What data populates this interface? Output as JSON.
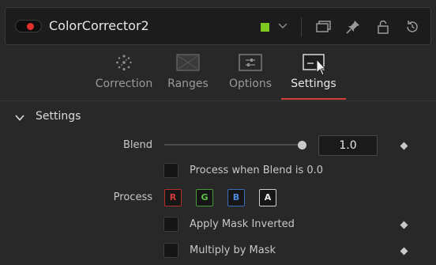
{
  "node": {
    "name": "ColorCorrector2",
    "toggle_color": "#e0322b",
    "swatch_color": "#7fc81d"
  },
  "titlebar_icons": [
    "color-swatch-dropdown-icon",
    "window-icon",
    "pin-icon",
    "lock-icon",
    "reset-icon"
  ],
  "tabs": [
    {
      "label": "Correction",
      "icon": "color-wheel-icon"
    },
    {
      "label": "Ranges",
      "icon": "image-icon"
    },
    {
      "label": "Options",
      "icon": "options-icon"
    },
    {
      "label": "Settings",
      "icon": "settings-icon",
      "active": true
    }
  ],
  "accent_color": "#d2413a",
  "section": {
    "title": "Settings",
    "blend": {
      "label": "Blend",
      "value": "1.0",
      "slider_fraction": 1.0
    },
    "process_when_blend_zero": {
      "label": "Process when Blend is 0.0",
      "checked": false
    },
    "process": {
      "label": "Process",
      "channels": [
        {
          "letter": "R",
          "color": "#d83a3a"
        },
        {
          "letter": "G",
          "color": "#5ec24a"
        },
        {
          "letter": "B",
          "color": "#3f7fd6"
        },
        {
          "letter": "A",
          "color": "#e8e8e8"
        }
      ]
    },
    "apply_mask_inverted": {
      "label": "Apply Mask Inverted",
      "checked": false
    },
    "multiply_by_mask": {
      "label": "Multiply by Mask",
      "checked": false
    }
  }
}
